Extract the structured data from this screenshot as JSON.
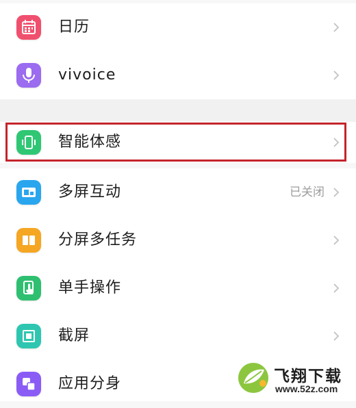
{
  "settings": {
    "items": [
      {
        "label": "日历",
        "status": "",
        "icon": "calendar-icon",
        "color": "#f0506e"
      },
      {
        "label": "vivoice",
        "status": "",
        "icon": "microphone-icon",
        "color": "#9b6bf0"
      },
      {
        "label": "智能体感",
        "status": "",
        "icon": "phone-motion-icon",
        "color": "#2fc774"
      },
      {
        "label": "多屏互动",
        "status": "已关闭",
        "icon": "screen-cast-icon",
        "color": "#2aa6ee"
      },
      {
        "label": "分屏多任务",
        "status": "",
        "icon": "split-screen-icon",
        "color": "#f5a623"
      },
      {
        "label": "单手操作",
        "status": "",
        "icon": "one-hand-icon",
        "color": "#2fbf71"
      },
      {
        "label": "截屏",
        "status": "",
        "icon": "screenshot-icon",
        "color": "#2ec6b0"
      },
      {
        "label": "应用分身",
        "status": "",
        "icon": "app-clone-icon",
        "color": "#8a5cf5"
      }
    ]
  },
  "watermark": {
    "title": "飞翔下载",
    "url": "www.52z.com",
    "logo_color": "#8cc63f"
  },
  "highlight_color": "#c4232b"
}
